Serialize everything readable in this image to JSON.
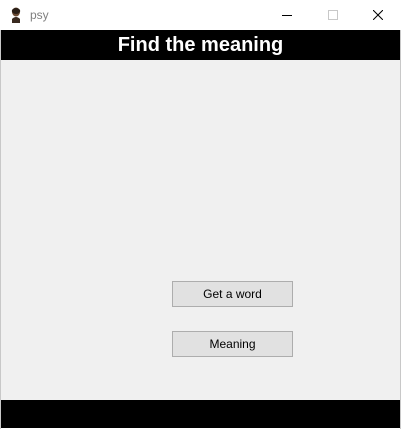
{
  "window": {
    "title": "psy",
    "controls": {
      "minimize_icon": "minimize-icon",
      "maximize_icon": "maximize-icon",
      "close_icon": "close-icon"
    }
  },
  "header": {
    "title": "Find the meaning"
  },
  "buttons": {
    "get_word_label": "Get a word",
    "meaning_label": "Meaning"
  },
  "colors": {
    "header_bg": "#000000",
    "header_text": "#ffffff",
    "content_bg": "#f0f0f0",
    "button_bg": "#e1e1e1",
    "button_border": "#adadad",
    "footer_bg": "#000000"
  }
}
